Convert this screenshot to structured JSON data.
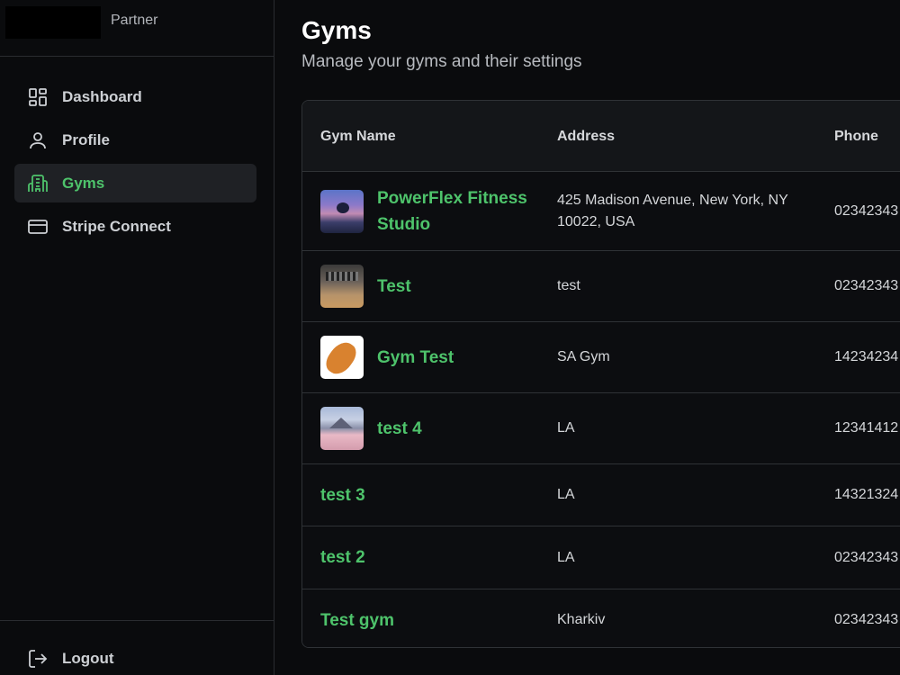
{
  "brand": {
    "suffix": "Partner"
  },
  "sidebar": {
    "items": [
      {
        "label": "Dashboard",
        "icon": "dashboard-grid-icon",
        "active": false
      },
      {
        "label": "Profile",
        "icon": "user-icon",
        "active": false
      },
      {
        "label": "Gyms",
        "icon": "building-icon",
        "active": true
      },
      {
        "label": "Stripe Connect",
        "icon": "credit-card-icon",
        "active": false
      }
    ],
    "logout_label": "Logout"
  },
  "page": {
    "title": "Gyms",
    "subtitle": "Manage your gyms and their settings"
  },
  "table": {
    "columns": [
      "Gym Name",
      "Address",
      "Phone"
    ],
    "rows": [
      {
        "name": "PowerFlex Fitness Studio",
        "address": "425 Madison Avenue, New York, NY 10022, USA",
        "phone": "02342343",
        "has_image": true
      },
      {
        "name": "Test",
        "address": "test",
        "phone": "02342343",
        "has_image": true
      },
      {
        "name": "Gym Test",
        "address": "SA Gym",
        "phone": "14234234",
        "has_image": true
      },
      {
        "name": "test 4",
        "address": "LA",
        "phone": "12341412",
        "has_image": true
      },
      {
        "name": "test 3",
        "address": "LA",
        "phone": "14321324",
        "has_image": false
      },
      {
        "name": "test 2",
        "address": "LA",
        "phone": "02342343",
        "has_image": false
      },
      {
        "name": "Test gym",
        "address": "Kharkiv",
        "phone": "02342343",
        "has_image": false
      }
    ]
  },
  "colors": {
    "accent": "#4ec36b",
    "background": "#0a0b0d",
    "active_nav_bg": "#1f2125",
    "border": "#2f3236"
  }
}
